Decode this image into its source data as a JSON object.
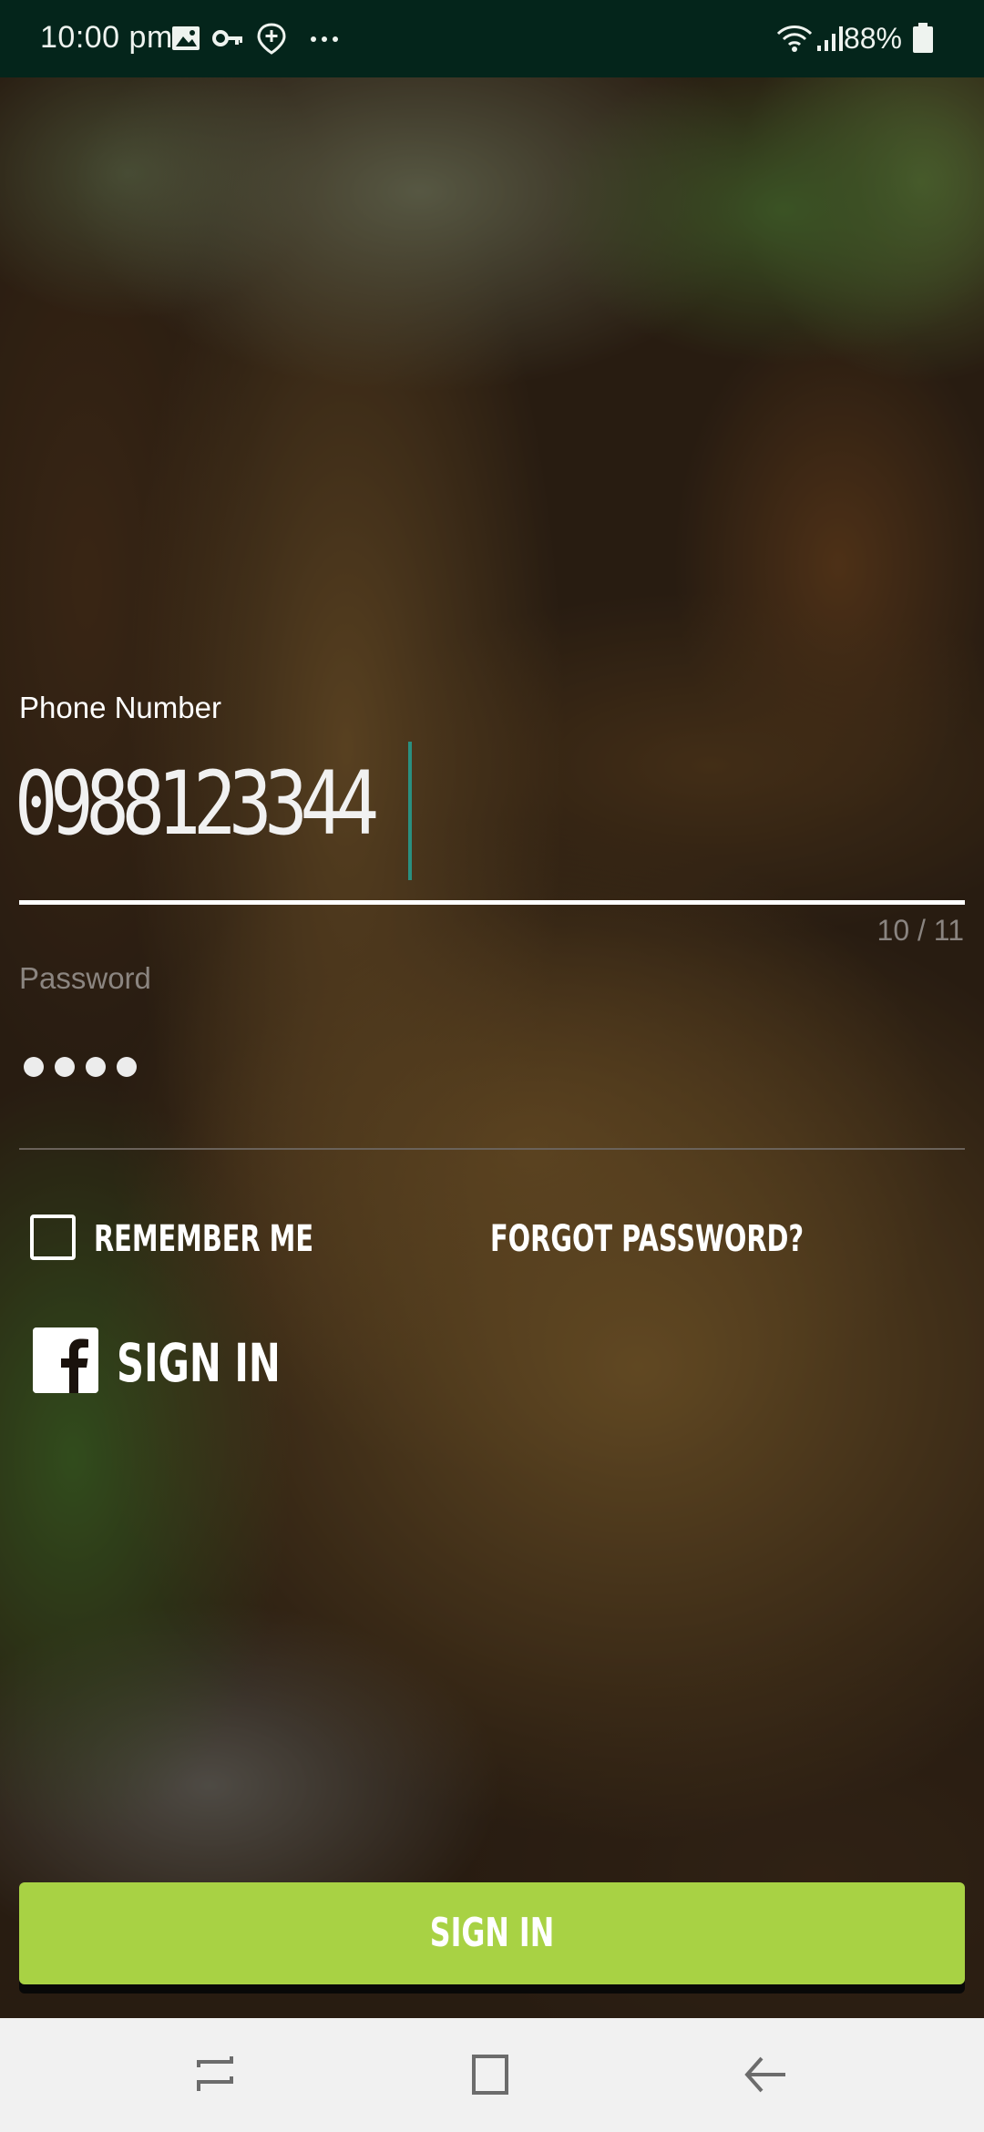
{
  "status_bar": {
    "time": "10:00 pm",
    "battery": "88%",
    "icons": [
      "image-icon",
      "key-icon",
      "location-add-icon",
      "more-dots-icon",
      "wifi-icon",
      "signal-icon",
      "battery-icon"
    ]
  },
  "form": {
    "phone_label": "Phone Number",
    "phone_value": "0988123344",
    "phone_counter": "10 / 11",
    "password_placeholder": "Password",
    "password_length": 4,
    "remember_label": "REMEMBER ME",
    "forgot_label": "FORGOT PASSWORD?",
    "facebook_signin_label": "SIGN IN",
    "signin_button_label": "SIGN IN"
  },
  "colors": {
    "status_bar": "#04251b",
    "accent_green": "#a8d244",
    "cursor": "#2a8f80",
    "nav_bar": "#f1f1f1"
  },
  "navigation_bar": {
    "buttons": [
      "recents-icon",
      "home-icon",
      "back-icon"
    ]
  }
}
